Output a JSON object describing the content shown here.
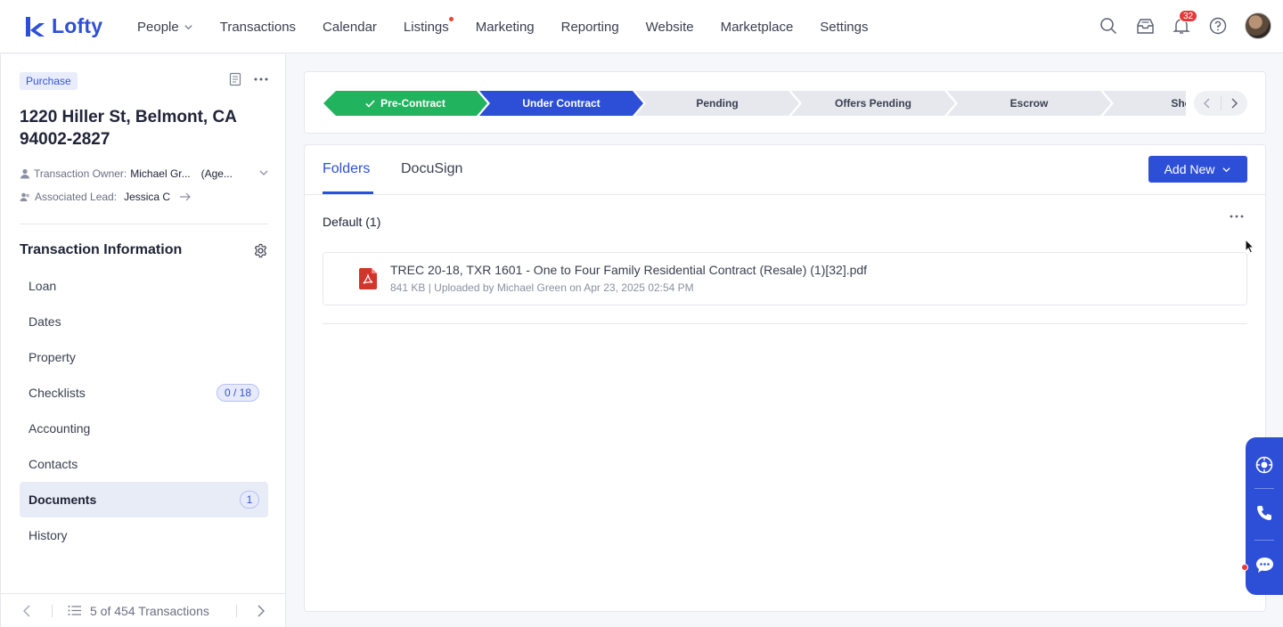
{
  "brand": {
    "name": "Lofty",
    "color": "#2d4fd8"
  },
  "nav": {
    "items": [
      {
        "label": "People",
        "dropdown": true
      },
      {
        "label": "Transactions"
      },
      {
        "label": "Calendar"
      },
      {
        "label": "Listings",
        "dot": true
      },
      {
        "label": "Marketing"
      },
      {
        "label": "Reporting"
      },
      {
        "label": "Website"
      },
      {
        "label": "Marketplace"
      },
      {
        "label": "Settings"
      }
    ],
    "notification_count": "32",
    "icons": [
      "search-icon",
      "inbox-icon",
      "bell-icon",
      "help-icon"
    ]
  },
  "transaction": {
    "type_tag": "Purchase",
    "address": "1220 Hiller St, Belmont, CA 94002-2827",
    "owner_label": "Transaction Owner:",
    "owner_name": "Michael Gr...",
    "owner_role": "(Age...",
    "lead_label": "Associated Lead:",
    "lead_name": "Jessica C"
  },
  "sidebar": {
    "section_title": "Transaction Information",
    "items": [
      {
        "label": "Loan"
      },
      {
        "label": "Dates"
      },
      {
        "label": "Property"
      },
      {
        "label": "Checklists",
        "badge": "0 / 18"
      },
      {
        "label": "Accounting"
      },
      {
        "label": "Contacts"
      },
      {
        "label": "Documents",
        "badge": "1",
        "active": true
      },
      {
        "label": "History"
      }
    ],
    "footer": {
      "count_text": "5 of 454 Transactions"
    }
  },
  "pipeline": {
    "stages": [
      {
        "label": "Pre-Contract",
        "status": "done"
      },
      {
        "label": "Under Contract",
        "status": "current"
      },
      {
        "label": "Pending",
        "status": "todo"
      },
      {
        "label": "Offers Pending",
        "status": "todo"
      },
      {
        "label": "Escrow",
        "status": "todo"
      },
      {
        "label": "Short",
        "status": "todo"
      }
    ],
    "colors": {
      "done": "#22b35e",
      "current": "#2d4fd8",
      "todo": "#e6e8ee"
    }
  },
  "documents": {
    "tabs": [
      {
        "label": "Folders",
        "active": true
      },
      {
        "label": "DocuSign"
      }
    ],
    "add_new_label": "Add New",
    "folder_title": "Default (1)",
    "files": [
      {
        "name": "TREC 20-18, TXR 1601 - One to Four Family Residential Contract (Resale) (1)[32].pdf",
        "meta": "841 KB | Uploaded by Michael Green on Apr 23, 2025 02:54 PM"
      }
    ]
  },
  "floatbar": {
    "icons": [
      "assistant-icon",
      "phone-icon",
      "chat-icon"
    ]
  }
}
